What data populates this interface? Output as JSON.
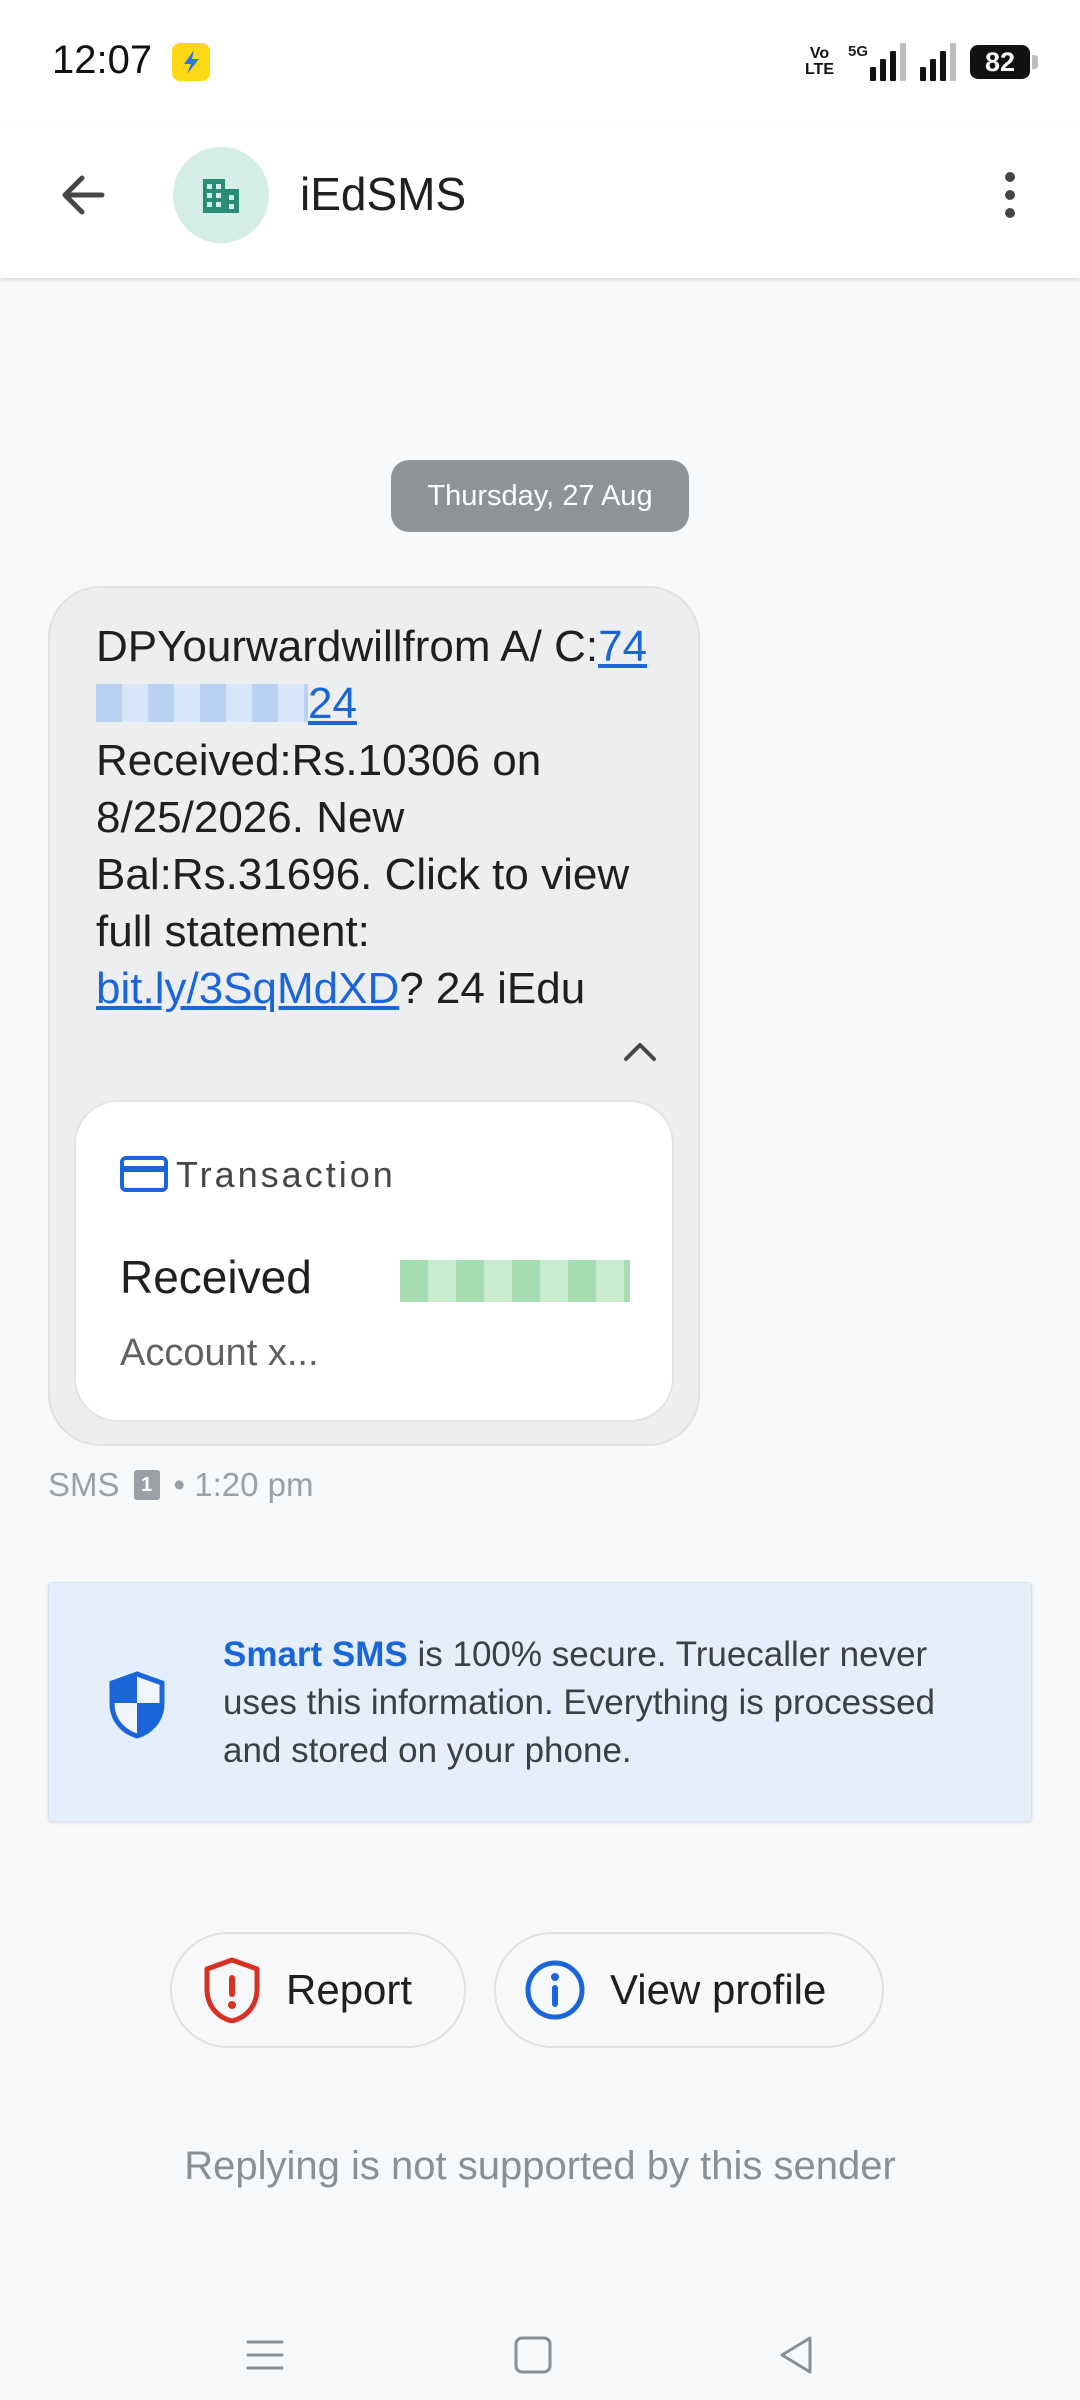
{
  "status_bar": {
    "time": "12:07",
    "network_label_top": "Vo",
    "network_label_bottom": "LTE",
    "network_5g": "5G",
    "battery": "82"
  },
  "app_bar": {
    "sender_name": "iEdSMS",
    "avatar_icon": "building-icon"
  },
  "conversation": {
    "date_chip": "Thursday, 27 Aug",
    "message": {
      "text_part1": "DPYourwardwillfrom A/ C:",
      "account_prefix": "74",
      "account_suffix": "24",
      "text_part2": " Received:Rs.10306 on 8/25/2026. New Bal:Rs.31696. Click to view full statement: ",
      "link": "bit.ly/3SqMdXD",
      "text_part3": "? 24 iEdu"
    },
    "transaction_card": {
      "title": "Transaction",
      "status": "Received",
      "account": "Account x..."
    },
    "meta": {
      "type": "SMS",
      "sim": "1",
      "time": "• 1:20 pm"
    }
  },
  "smart_banner": {
    "strong": "Smart SMS",
    "text": " is 100% secure. Truecaller never uses this information. Everything is processed and stored on your phone."
  },
  "actions": {
    "report": "Report",
    "view_profile": "View profile"
  },
  "reply_note": "Replying is not supported by this sender",
  "colors": {
    "accent_blue": "#1a66d9",
    "report_red": "#d93025",
    "avatar_green": "#2a8c75"
  }
}
